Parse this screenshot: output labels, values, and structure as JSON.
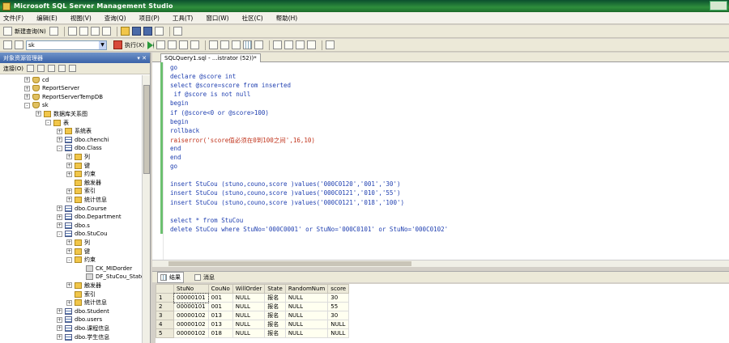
{
  "window": {
    "title": "Microsoft SQL Server Management Studio"
  },
  "menu": [
    "文件(F)",
    "编辑(E)",
    "视图(V)",
    "查询(Q)",
    "项目(P)",
    "工具(T)",
    "窗口(W)",
    "社区(C)",
    "帮助(H)"
  ],
  "toolbar1": {
    "new_query": "新建查询(N)"
  },
  "toolbar2": {
    "database": "sk",
    "execute": "执行(X)"
  },
  "object_explorer": {
    "title": "对象资源管理器",
    "connect": "连接(O)",
    "tree": [
      {
        "label": "cd",
        "icon": "db",
        "exp": "+"
      },
      {
        "label": "ReportServer",
        "icon": "db",
        "exp": "+"
      },
      {
        "label": "ReportServerTempDB",
        "icon": "db",
        "exp": "+"
      },
      {
        "label": "sk",
        "icon": "db",
        "exp": "-"
      },
      {
        "label": "数据库关系图",
        "icon": "folder",
        "exp": "+"
      },
      {
        "label": "表",
        "icon": "folder",
        "exp": "-"
      },
      {
        "label": "系统表",
        "icon": "folder",
        "exp": "+"
      },
      {
        "label": "dbo.chenchi",
        "icon": "table",
        "exp": "+"
      },
      {
        "label": "dbo.Class",
        "icon": "table",
        "exp": "-"
      },
      {
        "label": "列",
        "icon": "folder",
        "exp": "+"
      },
      {
        "label": "键",
        "icon": "folder",
        "exp": "+"
      },
      {
        "label": "约束",
        "icon": "folder",
        "exp": "+"
      },
      {
        "label": "触发器",
        "icon": "folder",
        "exp": ""
      },
      {
        "label": "索引",
        "icon": "folder",
        "exp": "+"
      },
      {
        "label": "统计信息",
        "icon": "folder",
        "exp": "+"
      },
      {
        "label": "dbo.Course",
        "icon": "table",
        "exp": "+"
      },
      {
        "label": "dbo.Department",
        "icon": "table",
        "exp": "+"
      },
      {
        "label": "dbo.s",
        "icon": "table",
        "exp": "+"
      },
      {
        "label": "dbo.StuCou",
        "icon": "table",
        "exp": "-"
      },
      {
        "label": "列",
        "icon": "folder",
        "exp": "+"
      },
      {
        "label": "键",
        "icon": "folder",
        "exp": "+"
      },
      {
        "label": "约束",
        "icon": "folder",
        "exp": "-"
      },
      {
        "label": "CK_MIDorder",
        "icon": "col",
        "exp": ""
      },
      {
        "label": "DF_StuCou_State",
        "icon": "col",
        "exp": ""
      },
      {
        "label": "触发器",
        "icon": "folder",
        "exp": "+"
      },
      {
        "label": "索引",
        "icon": "folder",
        "exp": ""
      },
      {
        "label": "统计信息",
        "icon": "folder",
        "exp": "+"
      },
      {
        "label": "dbo.Student",
        "icon": "table",
        "exp": "+"
      },
      {
        "label": "dbo.users",
        "icon": "table",
        "exp": "+"
      },
      {
        "label": "dbo.课程信息",
        "icon": "table",
        "exp": "+"
      },
      {
        "label": "dbo.学生信息",
        "icon": "table",
        "exp": "+"
      }
    ]
  },
  "editor": {
    "tab": "SQLQuery1.sql - ...istrator (52))*",
    "lines": [
      {
        "t": "go",
        "c": ""
      },
      {
        "t": "declare @score int",
        "c": ""
      },
      {
        "t": "select @score=score from inserted",
        "c": ""
      },
      {
        "t": " if @score is not null",
        "c": ""
      },
      {
        "t": "begin",
        "c": ""
      },
      {
        "t": "if (@score<0 or @score>100)",
        "c": ""
      },
      {
        "t": "begin",
        "c": ""
      },
      {
        "t": "rollback",
        "c": ""
      },
      {
        "t": "raiserror('score值必须在0到100之间',16,10)",
        "c": "red"
      },
      {
        "t": "end",
        "c": ""
      },
      {
        "t": "end",
        "c": ""
      },
      {
        "t": "go",
        "c": ""
      },
      {
        "t": "",
        "c": ""
      },
      {
        "t": "insert StuCou (stuno,couno,score )values('000C0120','001','30')",
        "c": ""
      },
      {
        "t": "insert StuCou (stuno,couno,score )values('000C0121','010','55')",
        "c": ""
      },
      {
        "t": "insert StuCou (stuno,couno,score )values('000C0121','018','100')",
        "c": ""
      },
      {
        "t": "",
        "c": ""
      },
      {
        "t": "select * from StuCou",
        "c": ""
      },
      {
        "t": "delete StuCou where StuNo='000C0001' or StuNo='000C0101' or StuNo='000C0102'",
        "c": ""
      }
    ]
  },
  "results": {
    "tab_results": "结果",
    "tab_messages": "消息",
    "columns": [
      "StuNo",
      "CouNo",
      "WillOrder",
      "State",
      "RandomNum",
      "score"
    ],
    "rows": [
      [
        "00000101",
        "001",
        "NULL",
        "报名",
        "NULL",
        "30"
      ],
      [
        "00000101",
        "001",
        "NULL",
        "报名",
        "NULL",
        "55"
      ],
      [
        "00000102",
        "013",
        "NULL",
        "报名",
        "NULL",
        "30"
      ],
      [
        "00000102",
        "013",
        "NULL",
        "报名",
        "NULL",
        "NULL"
      ],
      [
        "00000102",
        "018",
        "NULL",
        "报名",
        "NULL",
        "NULL"
      ]
    ]
  }
}
